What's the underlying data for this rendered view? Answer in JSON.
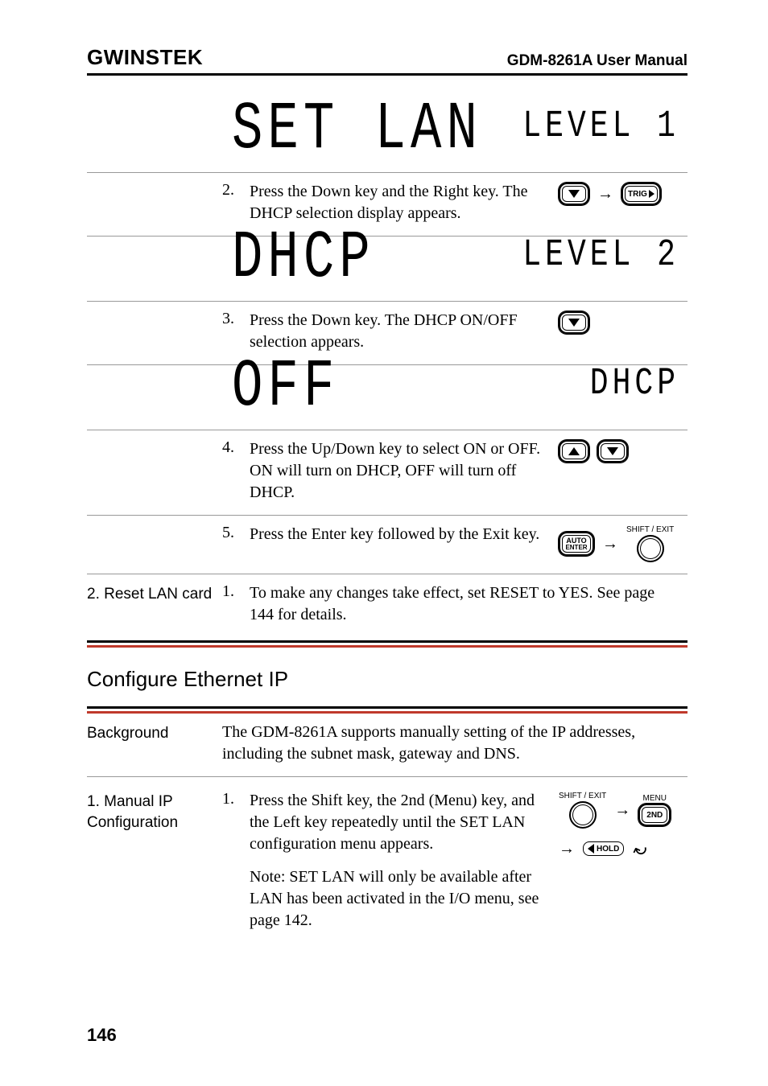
{
  "header": {
    "brand": "GWINSTEK",
    "manual": "GDM-8261A User Manual"
  },
  "lcd": {
    "setlan_big": "SET LAN",
    "setlan_small": "LEVEL 1",
    "dhcp_big": "DHCP",
    "dhcp_small": "LEVEL 2",
    "off_big": "OFF",
    "off_small": "DHCP"
  },
  "steps": {
    "s2_num": "2.",
    "s2_text": "Press the Down key and the Right key. The DHCP selection display appears.",
    "s3_num": "3.",
    "s3_text": "Press the Down key. The DHCP ON/OFF selection appears.",
    "s4_num": "4.",
    "s4_text": "Press the Up/Down key to select ON or OFF. ON will turn on DHCP, OFF will turn off DHCP.",
    "s5_num": "5.",
    "s5_text": "Press the Enter key followed by the Exit key."
  },
  "buttons": {
    "trig": "TRIG",
    "auto": "AUTO",
    "enter": "ENTER",
    "shift_exit": "SHIFT / EXIT",
    "menu": "MENU",
    "second": "2ND",
    "hold": "HOLD"
  },
  "reset": {
    "label": "2. Reset LAN card",
    "num": "1.",
    "text": "To make any changes take effect, set RESET to YES. See page 144 for details."
  },
  "section2": {
    "heading": "Configure Ethernet IP",
    "bg_label": "Background",
    "bg_text": "The GDM-8261A supports manually setting of the IP addresses, including the subnet mask, gateway and DNS.",
    "manual_label": "1. Manual IP Configuration",
    "m1_num": "1.",
    "m1_text": "Press the Shift key, the 2nd (Menu) key, and the Left key repeatedly until the SET LAN configuration menu appears.",
    "m1_note": "Note: SET LAN will only be available after LAN has been activated in the I/O menu, see page 142."
  },
  "page_number": "146"
}
